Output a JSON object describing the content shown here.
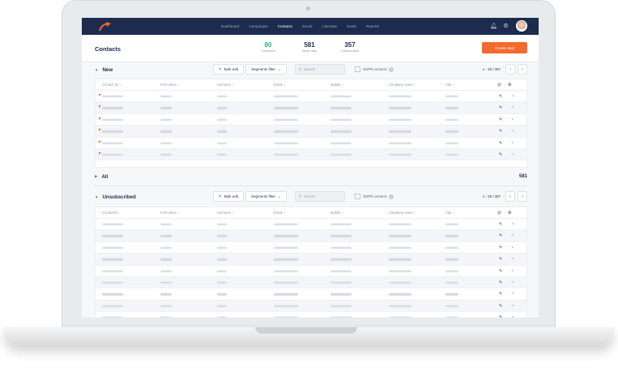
{
  "app": {
    "accent": "#f26a2e",
    "nav_bg": "#1d2b4f"
  },
  "nav": {
    "links": [
      "Dashboard",
      "Campaigns",
      "Contacts",
      "Social",
      "Calendar",
      "Deals",
      "Reports"
    ],
    "active": "Contacts",
    "icons": [
      "bell-icon",
      "gear-icon",
      "avatar"
    ]
  },
  "header": {
    "title": "Contacts",
    "stats": [
      {
        "value": "80",
        "label": "Customers",
        "color": "#2bb673"
      },
      {
        "value": "581",
        "label": "Whole data",
        "color": "#1d2b4f"
      },
      {
        "value": "357",
        "label": "Unsubscribed",
        "color": "#1d2b4f"
      }
    ],
    "create_button": "Create deal"
  },
  "toolbar": {
    "bulk_edit": "Bulk edit",
    "segments": "Segments filter",
    "search_placeholder": "Search",
    "gdpr": "GDPR consent"
  },
  "sections": {
    "new": {
      "title": "New",
      "pager": "1 - 25 / 357",
      "flagged": true
    },
    "all": {
      "title": "All",
      "count": "581"
    },
    "unsubscribed": {
      "title": "Unsubscribed",
      "pager": "1 - 25 / 357"
    }
  },
  "columns": [
    "Contact ID",
    "First name",
    "Surname",
    "Email",
    "Mobile",
    "Company name",
    "City"
  ],
  "unsub_columns": [
    "ContactID",
    "First name",
    "Surname",
    "Email",
    "Mobile",
    "Company name",
    "City"
  ]
}
